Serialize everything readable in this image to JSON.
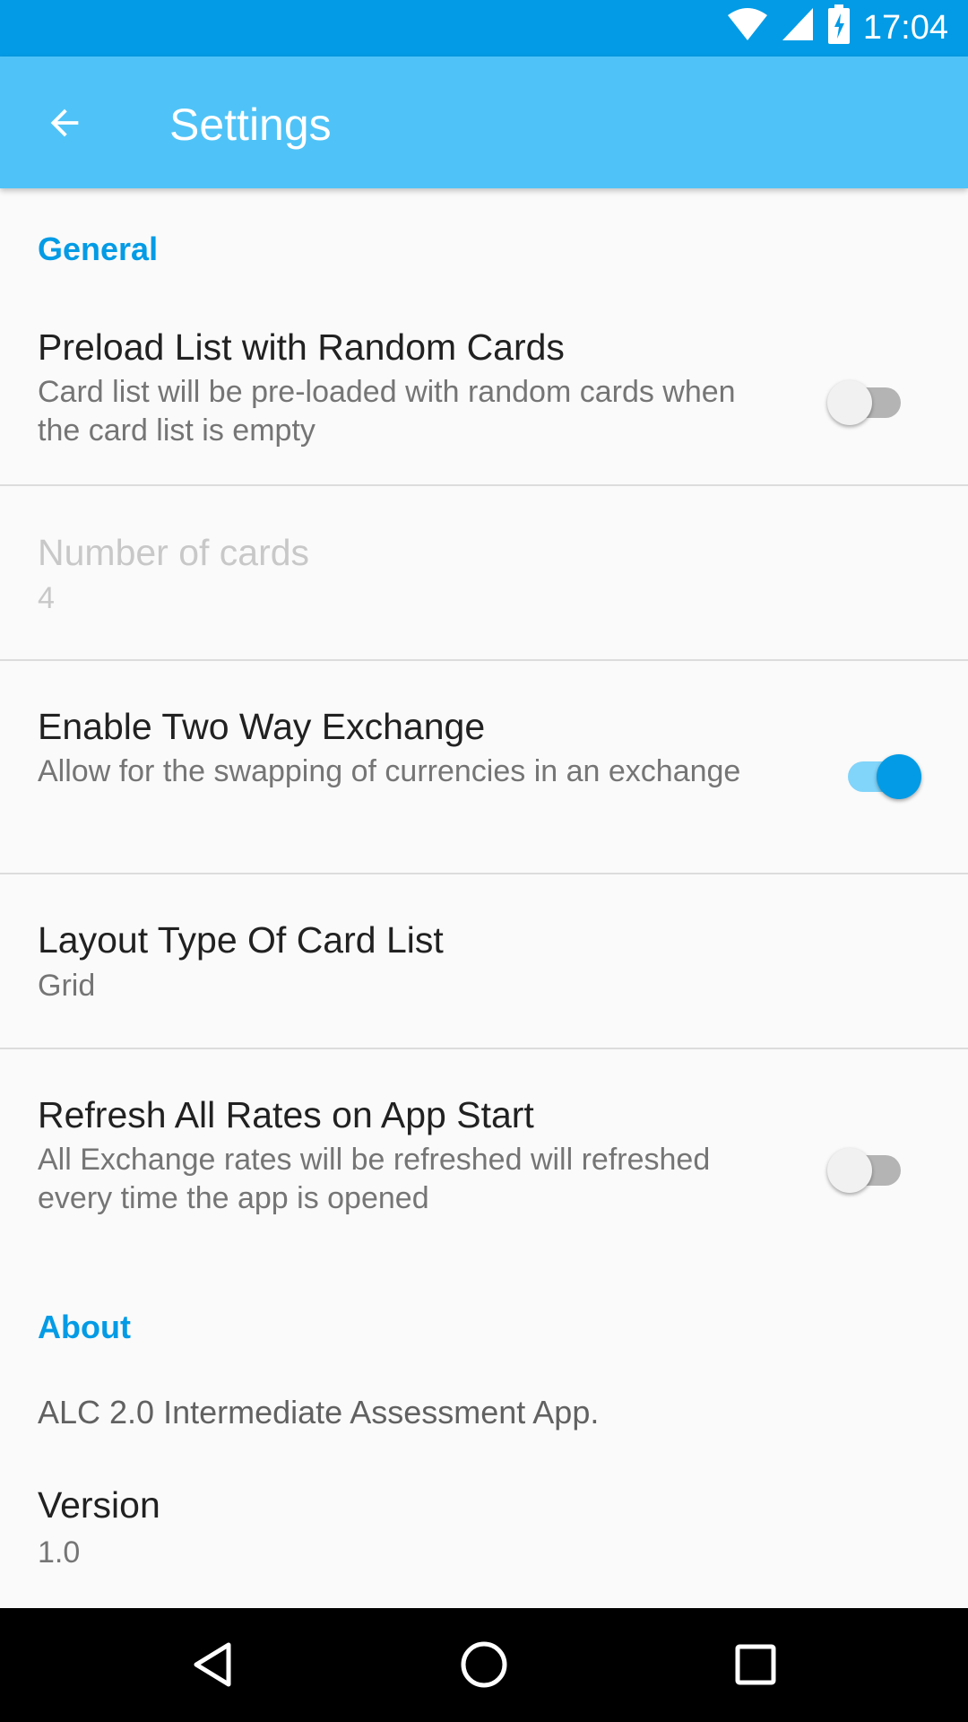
{
  "status_bar": {
    "time": "17:04",
    "icons": [
      "wifi-icon",
      "signal-icon",
      "battery-charging-icon"
    ]
  },
  "app_bar": {
    "title": "Settings",
    "back_icon": "arrow-back-icon"
  },
  "colors": {
    "status_bar": "#039be5",
    "app_bar": "#4fc3f7",
    "accent": "#039be5"
  },
  "sections": {
    "general": {
      "header": "General",
      "preload": {
        "title": "Preload List with Random Cards",
        "summary": "Card list will be pre-loaded with random cards when the card list is empty",
        "enabled": false
      },
      "number_of_cards": {
        "title": "Number of cards",
        "value": "4",
        "disabled": true
      },
      "two_way": {
        "title": "Enable Two Way Exchange",
        "summary": "Allow for the swapping of currencies in an exchange",
        "enabled": true
      },
      "layout_type": {
        "title": "Layout Type Of Card List",
        "value": "Grid"
      },
      "refresh": {
        "title": "Refresh All Rates on App Start",
        "summary": "All Exchange rates will be refreshed will refreshed every time the app is opened",
        "enabled": false
      }
    },
    "about": {
      "header": "About",
      "description": "ALC 2.0 Intermediate Assessment App.",
      "version": {
        "title": "Version",
        "value": "1.0"
      }
    }
  },
  "nav_bar": {
    "buttons": [
      "back-triangle-icon",
      "home-circle-icon",
      "recents-square-icon"
    ]
  }
}
